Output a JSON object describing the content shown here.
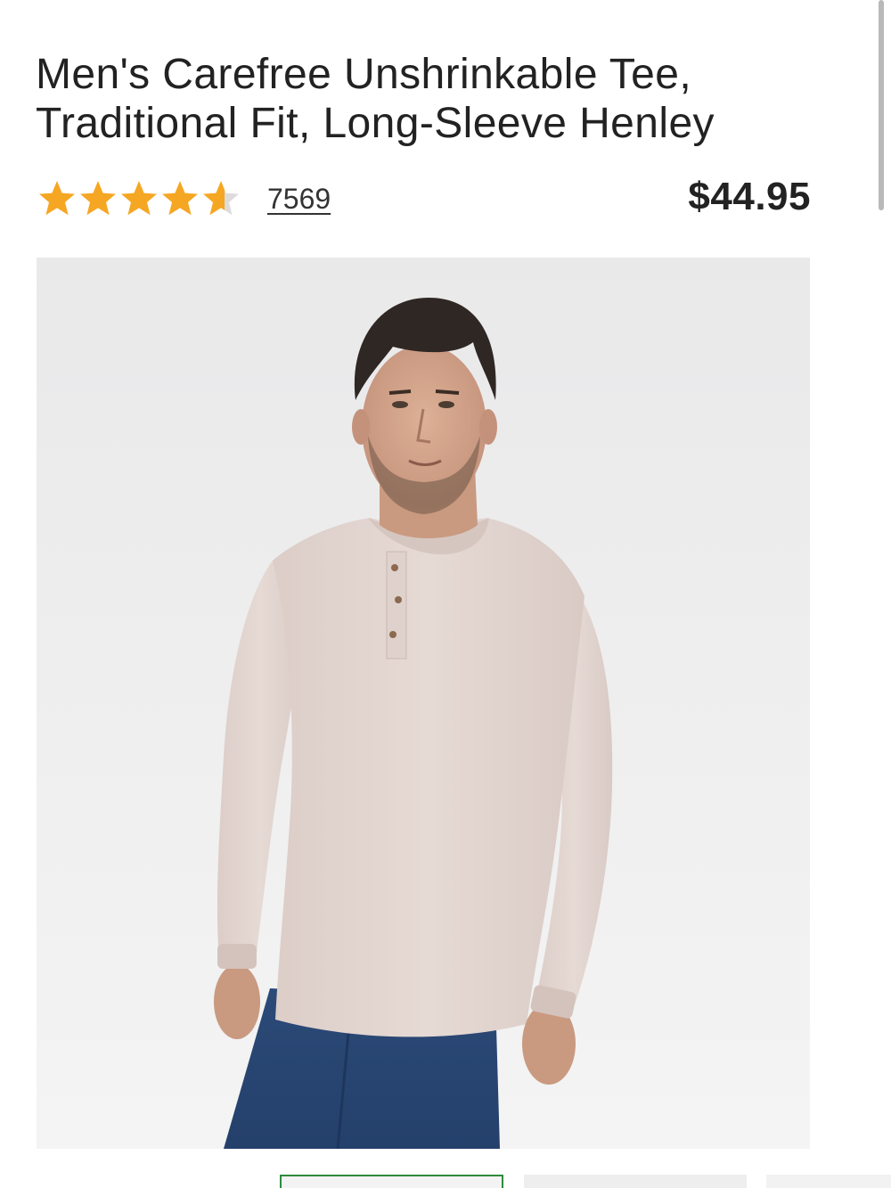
{
  "product": {
    "title_line_1": "Men's Carefree Unshrinkable Tee,",
    "title_line_2": "Traditional Fit, Long-Sleeve Henley",
    "rating": 4.6,
    "rating_max": 5,
    "review_count": "7569",
    "price": "$44.95"
  },
  "colors": {
    "star_fill": "#f5a623",
    "star_empty": "#dcdcdc",
    "active_thumb_border": "#2e8b3e",
    "shirt": "#e3d6d1"
  },
  "icons": {
    "star": "star-icon",
    "half_star": "star-half-icon"
  },
  "gallery": {
    "thumbnails": [
      {
        "state": "selected"
      },
      {
        "state": "default"
      },
      {
        "state": "default"
      }
    ]
  }
}
